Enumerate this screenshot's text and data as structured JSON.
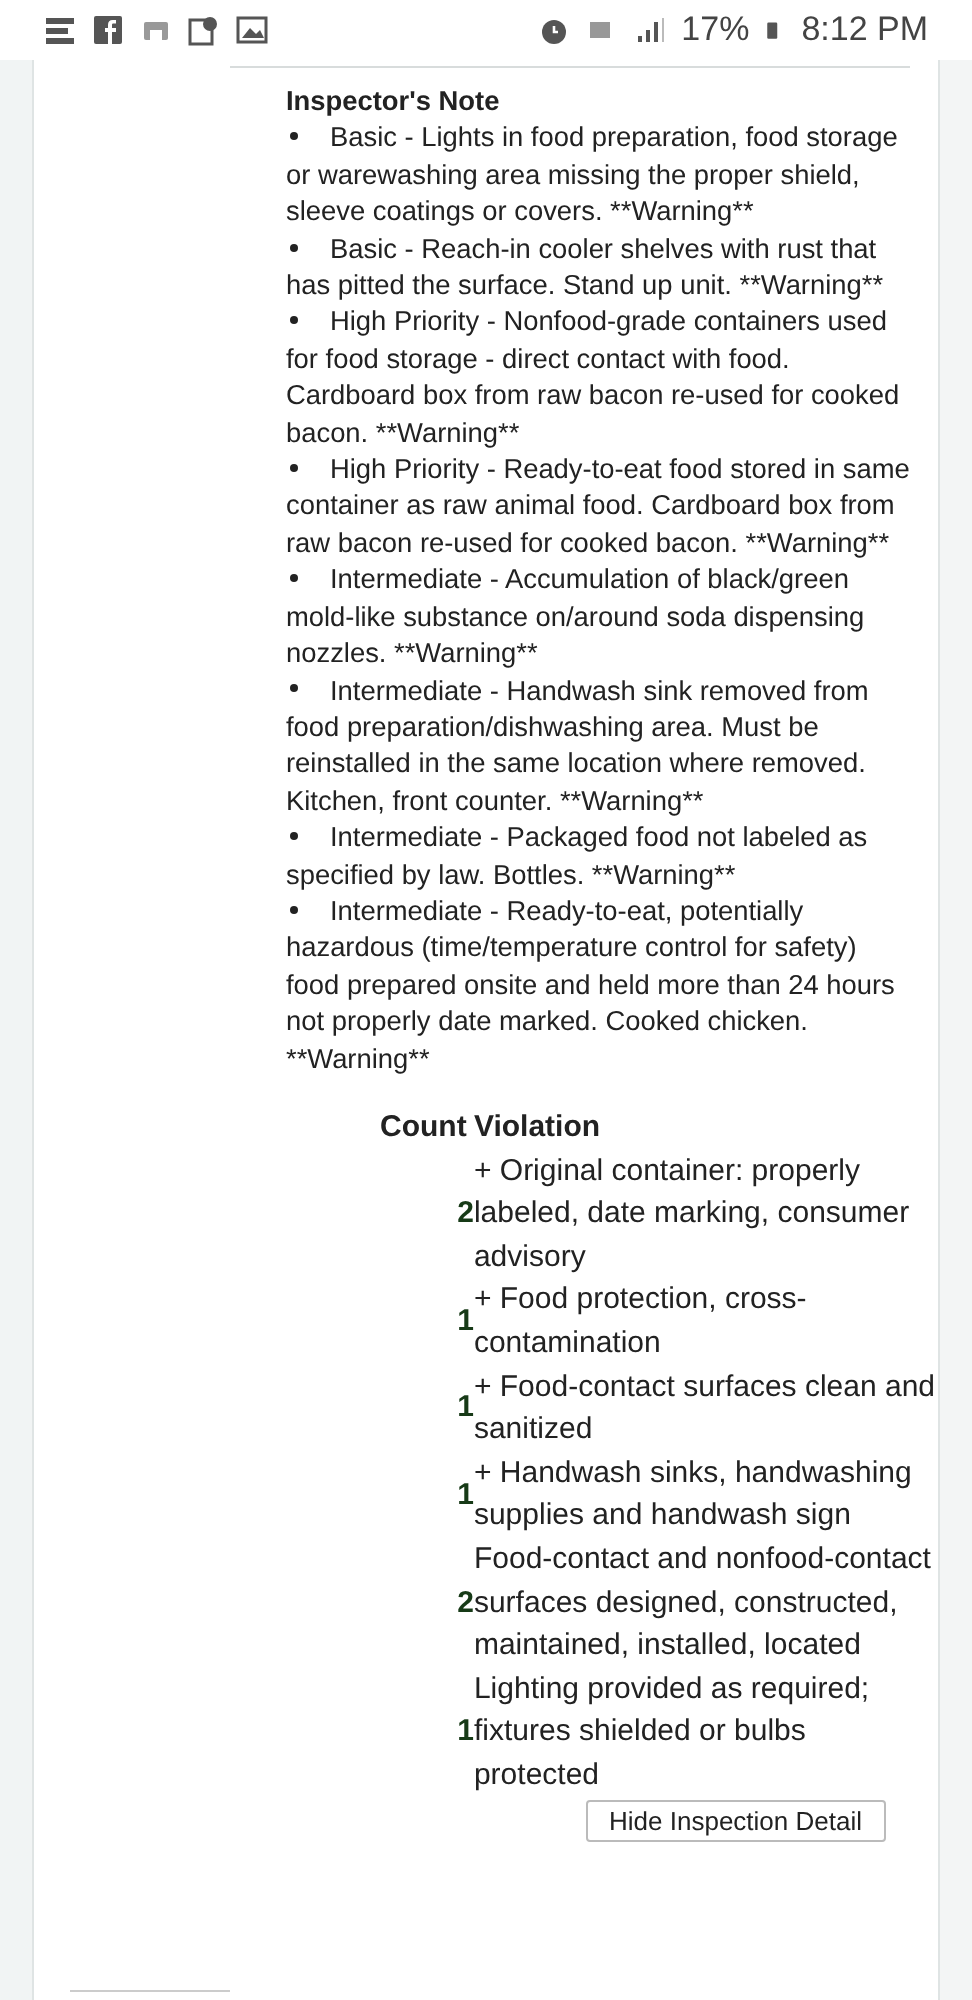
{
  "status_bar": {
    "battery": "17%",
    "time": "8:12 PM"
  },
  "inspector_note": {
    "title": "Inspector's Note",
    "items": [
      "Basic - Lights in food preparation, food storage or warewashing area missing the proper shield, sleeve coatings or covers. **Warning**",
      "Basic - Reach-in cooler shelves with rust that has pitted the surface. Stand up unit. **Warning**",
      "High Priority - Nonfood-grade containers used for food storage - direct contact with food. Cardboard box from raw bacon re-used for cooked bacon. **Warning**",
      "High Priority - Ready-to-eat food stored in same container as raw animal food. Cardboard box from raw bacon re-used for cooked bacon. **Warning**",
      "Intermediate - Accumulation of black/green mold-like substance on/around soda dispensing nozzles. **Warning**",
      "Intermediate - Handwash sink removed from food preparation/dishwashing area. Must be reinstalled in the same location where removed. Kitchen, front counter. **Warning**",
      "Intermediate - Packaged food not labeled as specified by law. Bottles. **Warning**",
      "Intermediate - Ready-to-eat, potentially hazardous (time/temperature control for safety) food prepared onsite and held more than 24 hours not properly date marked. Cooked chicken. **Warning**"
    ]
  },
  "violations_table": {
    "columns": [
      "Count",
      "Violation"
    ],
    "rows": [
      {
        "count": "2",
        "violation": "+ Original container: properly labeled, date marking, consumer advisory"
      },
      {
        "count": "1",
        "violation": "+ Food protection, cross-contamination"
      },
      {
        "count": "1",
        "violation": "+ Food-contact surfaces clean and sanitized"
      },
      {
        "count": "1",
        "violation": "+ Handwash sinks, handwashing supplies and handwash sign"
      },
      {
        "count": "2",
        "violation": "Food-contact and nonfood-contact surfaces designed, constructed, maintained, installed, located"
      },
      {
        "count": "1",
        "violation": "Lighting provided as required; fixtures shielded or bulbs protected"
      }
    ]
  },
  "hide_button": "Hide Inspection Detail"
}
